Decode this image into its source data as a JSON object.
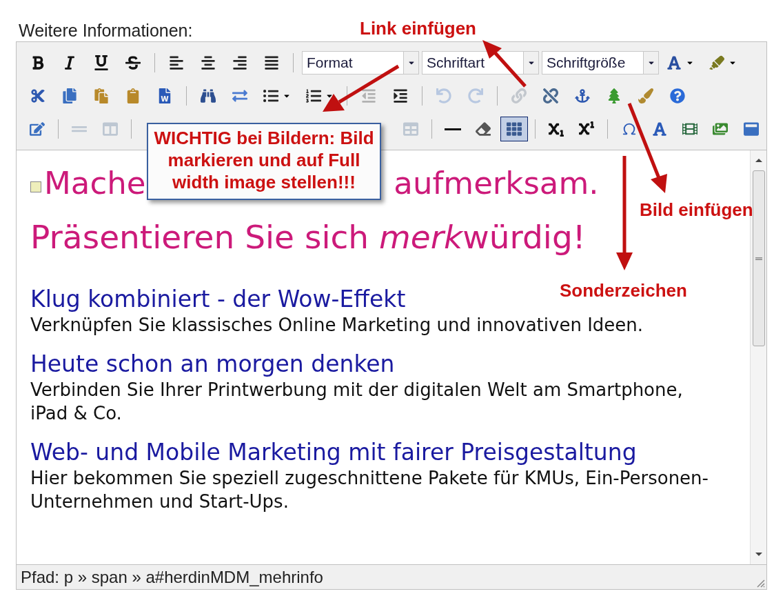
{
  "field_label": "Weitere Informationen:",
  "toolbar": {
    "rows": [
      {
        "items": [
          {
            "kind": "button",
            "disabled": false,
            "selected": false
          },
          {
            "kind": "button",
            "disabled": false,
            "selected": false
          },
          {
            "kind": "button",
            "disabled": false,
            "selected": false
          },
          {
            "kind": "button",
            "disabled": false,
            "selected": false
          },
          {
            "kind": "separator"
          },
          {
            "kind": "button",
            "disabled": false,
            "selected": false
          },
          {
            "kind": "button",
            "disabled": false,
            "selected": false
          },
          {
            "kind": "button",
            "disabled": false,
            "selected": false
          },
          {
            "kind": "button",
            "disabled": false,
            "selected": false
          },
          {
            "kind": "separator"
          },
          {
            "kind": "select",
            "label": "Format"
          },
          {
            "kind": "select",
            "label": "Schriftart"
          },
          {
            "kind": "select",
            "label": "Schriftgröße"
          },
          {
            "kind": "split",
            "disabled": false,
            "selected": false
          },
          {
            "kind": "split",
            "disabled": false,
            "selected": false
          }
        ]
      },
      {
        "items": [
          {
            "kind": "button",
            "disabled": false,
            "selected": false
          },
          {
            "kind": "button",
            "disabled": false,
            "selected": false
          },
          {
            "kind": "button",
            "disabled": false,
            "selected": false
          },
          {
            "kind": "button",
            "disabled": false,
            "selected": false
          },
          {
            "kind": "button",
            "disabled": false,
            "selected": false
          },
          {
            "kind": "separator"
          },
          {
            "kind": "button",
            "disabled": false,
            "selected": false
          },
          {
            "kind": "button",
            "disabled": false,
            "selected": false
          },
          {
            "kind": "split",
            "disabled": false,
            "selected": false
          },
          {
            "kind": "split",
            "disabled": false,
            "selected": false
          },
          {
            "kind": "separator"
          },
          {
            "kind": "button",
            "disabled": true,
            "selected": false
          },
          {
            "kind": "button",
            "disabled": false,
            "selected": false
          },
          {
            "kind": "separator"
          },
          {
            "kind": "button",
            "disabled": true,
            "selected": false
          },
          {
            "kind": "button",
            "disabled": true,
            "selected": false
          },
          {
            "kind": "separator"
          },
          {
            "kind": "button",
            "disabled": true,
            "selected": false
          },
          {
            "kind": "button",
            "disabled": false,
            "selected": false
          },
          {
            "kind": "button",
            "disabled": false,
            "selected": false
          },
          {
            "kind": "button",
            "disabled": false,
            "selected": false
          },
          {
            "kind": "button",
            "disabled": false,
            "selected": false
          },
          {
            "kind": "button",
            "disabled": false,
            "selected": false
          }
        ]
      },
      {
        "items": [
          {
            "kind": "button",
            "disabled": false,
            "selected": false
          },
          {
            "kind": "separator"
          },
          {
            "kind": "button",
            "disabled": true,
            "selected": false
          },
          {
            "kind": "button",
            "disabled": true,
            "selected": false
          },
          {
            "kind": "separator"
          },
          {
            "kind": "button",
            "disabled": true,
            "selected": false
          },
          {
            "kind": "separator"
          },
          {
            "kind": "button",
            "disabled": false,
            "selected": false
          },
          {
            "kind": "button",
            "disabled": false,
            "selected": false
          },
          {
            "kind": "button",
            "disabled": false,
            "selected": true
          },
          {
            "kind": "separator"
          },
          {
            "kind": "button",
            "disabled": false,
            "selected": false
          },
          {
            "kind": "button",
            "disabled": false,
            "selected": false
          },
          {
            "kind": "separator"
          },
          {
            "kind": "button",
            "disabled": false,
            "selected": false
          },
          {
            "kind": "button",
            "disabled": false,
            "selected": false
          },
          {
            "kind": "button",
            "disabled": false,
            "selected": false
          },
          {
            "kind": "button",
            "disabled": false,
            "selected": false
          },
          {
            "kind": "button",
            "disabled": false,
            "selected": false
          }
        ]
      }
    ]
  },
  "content": {
    "heading_1": [
      "Mache",
      "aufmerksam."
    ],
    "heading_2": [
      {
        "text": "Präsentieren Sie sich ",
        "italic": false
      },
      {
        "text": "merk",
        "italic": true
      },
      {
        "text": "würdig!",
        "italic": false
      }
    ],
    "sections": [
      {
        "title": "Klug kombiniert - der Wow-Effekt",
        "text": "Verknüpfen Sie klassisches Online Marketing und innovativen Ideen."
      },
      {
        "title": "Heute schon an morgen denken",
        "text": "Verbinden Sie Ihrer Printwerbung mit der digitalen Welt am Smartphone, iPad & Co."
      },
      {
        "title": "Web- und Mobile Marketing mit fairer Preisgestaltung",
        "text": "Hier bekommen Sie speziell zugeschnittene Pakete für KMUs, Ein-Personen-Unternehmen und Start-Ups."
      }
    ]
  },
  "status_bar": {
    "path": "Pfad: p » span » a#herdinMDM_mehrinfo"
  },
  "annotations": {
    "callout": "WICHTIG bei Bildern: Bild\nmarkieren und auf Full\nwidth image stellen!!!",
    "labels": [
      {
        "text": "Link einfügen"
      },
      {
        "text": "Bild einfügen"
      },
      {
        "text": "Sonderzeichen"
      }
    ]
  }
}
